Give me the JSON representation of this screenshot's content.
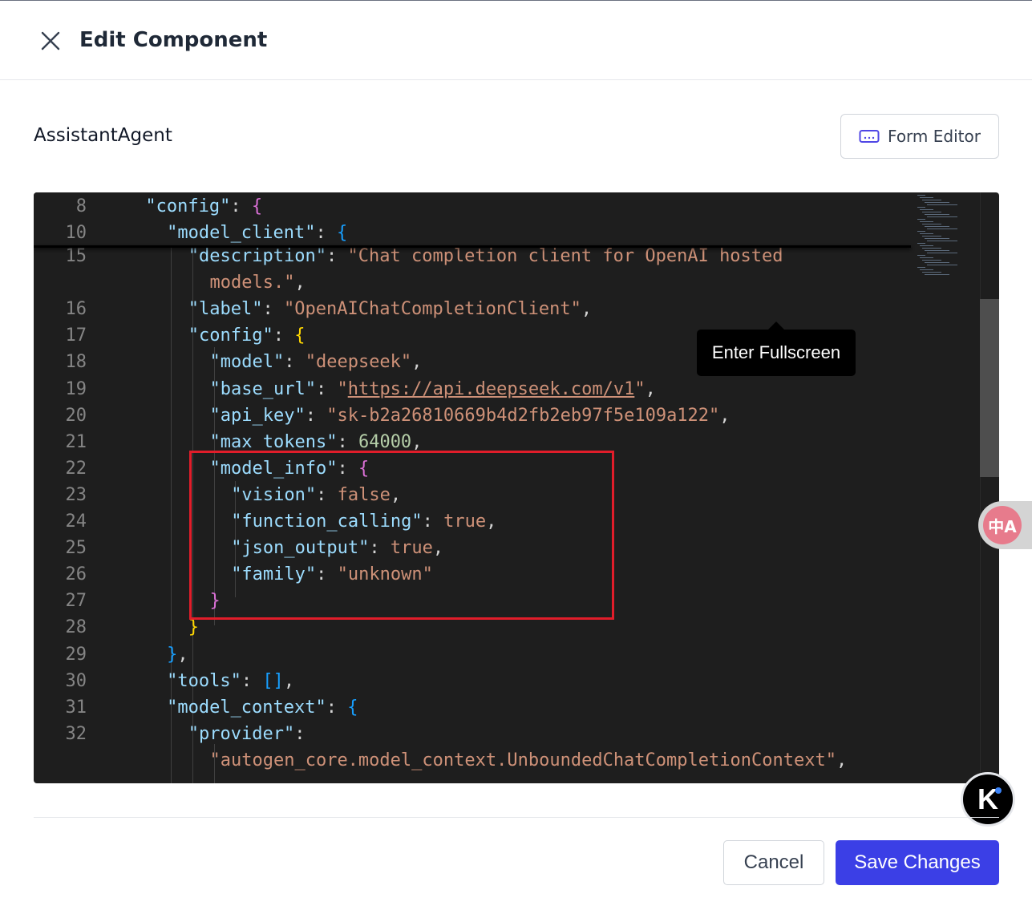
{
  "header": {
    "title": "Edit Component",
    "close_icon": "close-icon"
  },
  "component": {
    "name": "AssistantAgent"
  },
  "toolbar": {
    "form_editor_label": "Form Editor",
    "form_editor_icon": "keyboard-icon"
  },
  "tooltip": {
    "text": "Enter Fullscreen"
  },
  "editor": {
    "sticky_lines": [
      {
        "num": "8",
        "indent": 4,
        "tokens": [
          [
            "k",
            "\"config\""
          ],
          [
            "p",
            ": "
          ],
          [
            "b2",
            "{"
          ]
        ]
      },
      {
        "num": "10",
        "indent": 6,
        "tokens": [
          [
            "k",
            "\"model_client\""
          ],
          [
            "p",
            ": "
          ],
          [
            "b3",
            "{"
          ]
        ]
      }
    ],
    "lines": [
      {
        "num": "15",
        "indent": 8,
        "tokens": [
          [
            "k",
            "\"description\""
          ],
          [
            "p",
            ": "
          ],
          [
            "s",
            "\"Chat completion client for OpenAI hosted"
          ]
        ]
      },
      {
        "num": "",
        "indent": 10,
        "tokens": [
          [
            "s",
            "models.\""
          ],
          [
            "p",
            ","
          ]
        ]
      },
      {
        "num": "16",
        "indent": 8,
        "tokens": [
          [
            "k",
            "\"label\""
          ],
          [
            "p",
            ": "
          ],
          [
            "s",
            "\"OpenAIChatCompletionClient\""
          ],
          [
            "p",
            ","
          ]
        ]
      },
      {
        "num": "17",
        "indent": 8,
        "tokens": [
          [
            "k",
            "\"config\""
          ],
          [
            "p",
            ": "
          ],
          [
            "b1",
            "{"
          ]
        ]
      },
      {
        "num": "18",
        "indent": 10,
        "tokens": [
          [
            "k",
            "\"model\""
          ],
          [
            "p",
            ": "
          ],
          [
            "s",
            "\"deepseek\""
          ],
          [
            "p",
            ","
          ]
        ]
      },
      {
        "num": "19",
        "indent": 10,
        "tokens": [
          [
            "k",
            "\"base_url\""
          ],
          [
            "p",
            ": "
          ],
          [
            "s",
            "\""
          ],
          [
            "su",
            "https://api.deepseek.com/v1"
          ],
          [
            "s",
            "\""
          ],
          [
            "p",
            ","
          ]
        ]
      },
      {
        "num": "20",
        "indent": 10,
        "tokens": [
          [
            "k",
            "\"api_key\""
          ],
          [
            "p",
            ": "
          ],
          [
            "s",
            "\"sk-b2a26810669b4d2fb2eb97f5e109a122\""
          ],
          [
            "p",
            ","
          ]
        ]
      },
      {
        "num": "21",
        "indent": 10,
        "tokens": [
          [
            "k",
            "\"max_tokens\""
          ],
          [
            "p",
            ": "
          ],
          [
            "n",
            "64000"
          ],
          [
            "p",
            ","
          ]
        ]
      },
      {
        "num": "22",
        "indent": 10,
        "tokens": [
          [
            "k",
            "\"model_info\""
          ],
          [
            "p",
            ": "
          ],
          [
            "b2",
            "{"
          ]
        ]
      },
      {
        "num": "23",
        "indent": 12,
        "tokens": [
          [
            "k",
            "\"vision\""
          ],
          [
            "p",
            ": "
          ],
          [
            "s",
            "false"
          ],
          [
            "p",
            ","
          ]
        ]
      },
      {
        "num": "24",
        "indent": 12,
        "tokens": [
          [
            "k",
            "\"function_calling\""
          ],
          [
            "p",
            ": "
          ],
          [
            "s",
            "true"
          ],
          [
            "p",
            ","
          ]
        ]
      },
      {
        "num": "25",
        "indent": 12,
        "tokens": [
          [
            "k",
            "\"json_output\""
          ],
          [
            "p",
            ": "
          ],
          [
            "s",
            "true"
          ],
          [
            "p",
            ","
          ]
        ]
      },
      {
        "num": "26",
        "indent": 12,
        "tokens": [
          [
            "k",
            "\"family\""
          ],
          [
            "p",
            ": "
          ],
          [
            "s",
            "\"unknown\""
          ]
        ]
      },
      {
        "num": "27",
        "indent": 10,
        "tokens": [
          [
            "b2",
            "}"
          ]
        ]
      },
      {
        "num": "28",
        "indent": 8,
        "tokens": [
          [
            "b1",
            "}"
          ]
        ]
      },
      {
        "num": "29",
        "indent": 6,
        "tokens": [
          [
            "b3",
            "}"
          ],
          [
            "p",
            ","
          ]
        ]
      },
      {
        "num": "30",
        "indent": 6,
        "tokens": [
          [
            "k",
            "\"tools\""
          ],
          [
            "p",
            ": "
          ],
          [
            "b3",
            "[]"
          ],
          [
            "p",
            ","
          ]
        ]
      },
      {
        "num": "31",
        "indent": 6,
        "tokens": [
          [
            "k",
            "\"model_context\""
          ],
          [
            "p",
            ": "
          ],
          [
            "b3",
            "{"
          ]
        ]
      },
      {
        "num": "32",
        "indent": 8,
        "tokens": [
          [
            "k",
            "\"provider\""
          ],
          [
            "p",
            ":"
          ]
        ]
      },
      {
        "num": "",
        "indent": 10,
        "tokens": [
          [
            "s",
            "\"autogen_core.model_context.UnboundedChatCompletionContext\""
          ],
          [
            "p",
            ","
          ]
        ]
      }
    ]
  },
  "widgets": {
    "translate_icon": "translate-icon",
    "translate_glyph": "中A",
    "assistant_icon": "k-logo-icon",
    "assistant_glyph": "K"
  },
  "footer": {
    "cancel_label": "Cancel",
    "save_label": "Save Changes"
  },
  "colors": {
    "save_button": "#3b3fe6",
    "highlight_box": "#e11d2a",
    "editor_bg": "#1e1e1e"
  }
}
